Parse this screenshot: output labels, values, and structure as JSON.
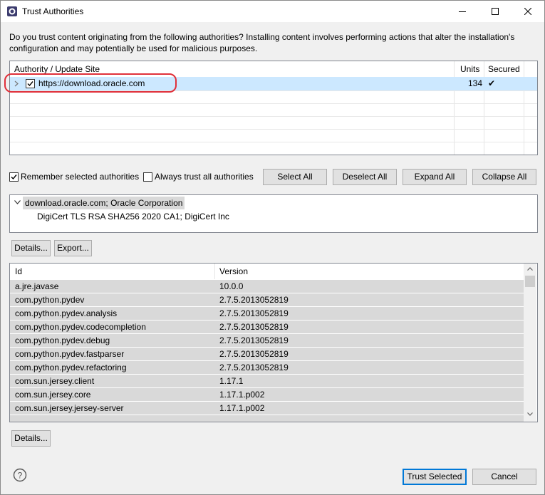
{
  "window": {
    "title": "Trust Authorities",
    "description": "Do you trust content originating from the following authorities?  Installing content involves performing actions that alter the installation's configuration and may potentially be used for malicious purposes."
  },
  "sites": {
    "headers": {
      "authority": "Authority / Update Site",
      "units": "Units",
      "secured": "Secured"
    },
    "rows": [
      {
        "url": "https://download.oracle.com",
        "units": "134",
        "secured": "✔",
        "checked": true
      }
    ]
  },
  "options": {
    "remember": "Remember selected authorities",
    "always_trust": "Always trust all authorities",
    "remember_checked": true,
    "always_trust_checked": false
  },
  "buttons": {
    "select_all": "Select All",
    "deselect_all": "Deselect All",
    "expand_all": "Expand All",
    "collapse_all": "Collapse All",
    "details_top": "Details...",
    "export": "Export...",
    "details_bottom": "Details...",
    "trust_selected": "Trust Selected",
    "cancel": "Cancel"
  },
  "certificates": {
    "root": "download.oracle.com; Oracle Corporation",
    "child": "DigiCert TLS RSA SHA256 2020 CA1; DigiCert Inc"
  },
  "units": {
    "headers": {
      "id": "Id",
      "version": "Version"
    },
    "rows": [
      {
        "id": "a.jre.javase",
        "version": "10.0.0"
      },
      {
        "id": "com.python.pydev",
        "version": "2.7.5.2013052819"
      },
      {
        "id": "com.python.pydev.analysis",
        "version": "2.7.5.2013052819"
      },
      {
        "id": "com.python.pydev.codecompletion",
        "version": "2.7.5.2013052819"
      },
      {
        "id": "com.python.pydev.debug",
        "version": "2.7.5.2013052819"
      },
      {
        "id": "com.python.pydev.fastparser",
        "version": "2.7.5.2013052819"
      },
      {
        "id": "com.python.pydev.refactoring",
        "version": "2.7.5.2013052819"
      },
      {
        "id": "com.sun.jersey.client",
        "version": "1.17.1"
      },
      {
        "id": "com.sun.jersey.core",
        "version": "1.17.1.p002"
      },
      {
        "id": "com.sun.jersey.jersey-server",
        "version": "1.17.1.p002"
      }
    ]
  }
}
